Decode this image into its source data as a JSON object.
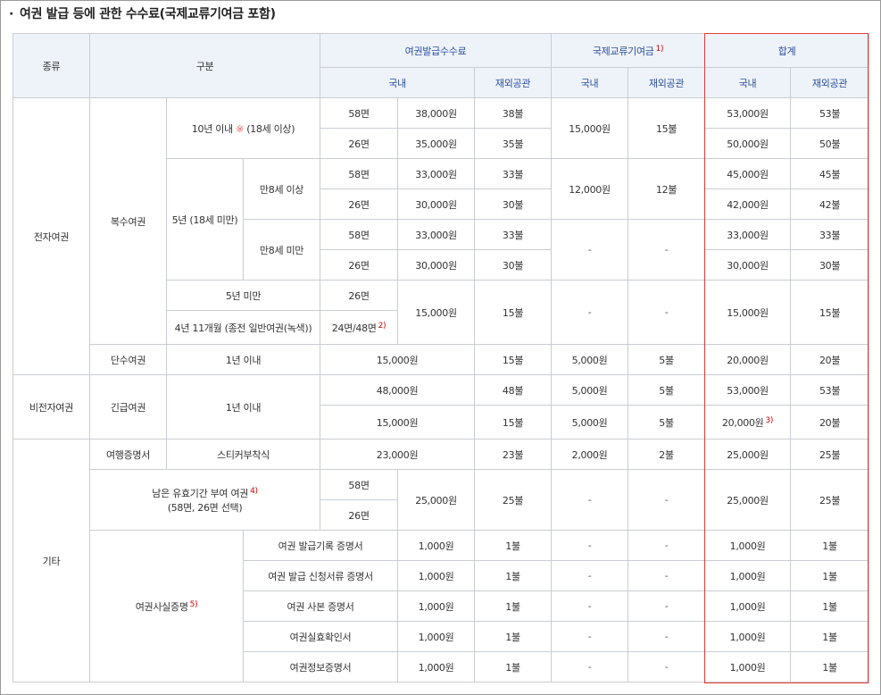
{
  "heading": "여권 발급 등에 관한 수수료(국제교류기여금 포함)",
  "header": {
    "type": "종류",
    "category": "구분",
    "issue_fee": "여권발급수수료",
    "intl_fund": "국제교류기여금",
    "intl_fund_note": "1)",
    "total": "합계",
    "domestic": "국내",
    "overseas": "재외공관"
  },
  "types": {
    "electronic": "전자여권",
    "non_electronic": "비전자여권",
    "other": "기타"
  },
  "sub": {
    "multiple": "복수여권",
    "single": "단수여권",
    "emergency": "긴급여권",
    "travel_cert": "여행증명서",
    "remaining_validity": "남은 유효기간 부여 여권",
    "remaining_validity_note": "4)",
    "remaining_validity_sub": "(58면, 26면 선택)",
    "fact_cert": "여권사실증명",
    "fact_cert_note": "5)"
  },
  "periods": {
    "ten_years": "10년 이내",
    "ten_years_mark": "※",
    "ten_years_age": "(18세 이상)",
    "five_years": "5년 (18세 미만)",
    "age8_over": "만8세 이상",
    "age8_under": "만8세 미만",
    "under_five": "5년 미만",
    "four_years": "4년 11개월 (종전 일반여권(녹색))",
    "one_year": "1년 이내",
    "sticker": "스티커부착식"
  },
  "pages": {
    "p58": "58면",
    "p26": "26면",
    "p24_48": "24면/48면",
    "p24_48_note": "2)"
  },
  "values": {
    "k38000": "38,000원",
    "d38": "38불",
    "k35000": "35,000원",
    "d35": "35불",
    "k33000": "33,000원",
    "d33": "33불",
    "k30000": "30,000원",
    "d30": "30불",
    "k15000": "15,000원",
    "d15": "15불",
    "k12000": "12,000원",
    "d12": "12불",
    "k5000": "5,000원",
    "d5": "5불",
    "k48000": "48,000원",
    "d48": "48불",
    "k23000": "23,000원",
    "d23": "23불",
    "k2000": "2,000원",
    "d2": "2불",
    "k25000": "25,000원",
    "d25": "25불",
    "k53000": "53,000원",
    "d53": "53불",
    "k50000": "50,000원",
    "d50": "50불",
    "k45000": "45,000원",
    "d45": "45불",
    "k42000": "42,000원",
    "d42": "42불",
    "k20000": "20,000원",
    "d20": "20불",
    "k20000_note": "3)",
    "k1000": "1,000원",
    "d1": "1불",
    "dash": "-"
  },
  "fact_certs": [
    "여권 발급기록 증명서",
    "여권 발급 신청서류 증명서",
    "여권 사본 증명서",
    "여권실효확인서",
    "여권정보증명서"
  ],
  "colors": {
    "header_bg": "#eef3fa",
    "header_text": "#2b4f9c",
    "border": "#c9cdd2",
    "highlight_box": "#e23b3b",
    "footnote": "#d10000"
  }
}
